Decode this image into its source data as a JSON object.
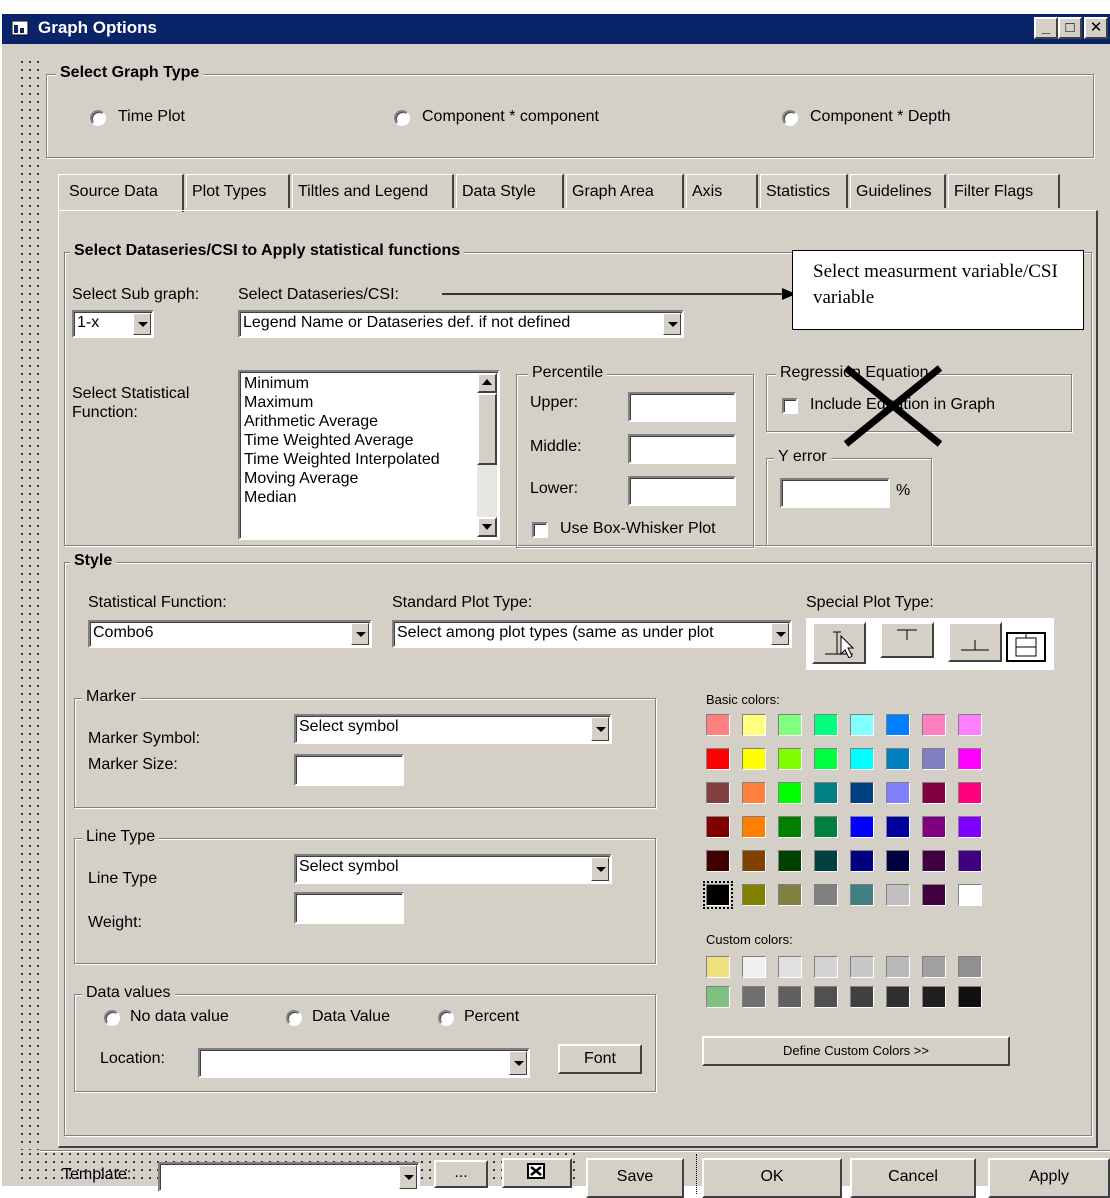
{
  "window": {
    "title": "Graph Options"
  },
  "graph_type": {
    "legend": "Select Graph Type",
    "options": [
      "Time Plot",
      "Component * component",
      "Component * Depth"
    ]
  },
  "tabs": [
    "Source Data",
    "Plot Types",
    "Tiltles and Legend",
    "Data Style",
    "Graph Area",
    "Axis",
    "Statistics",
    "Guidelines",
    "Filter Flags"
  ],
  "dataseries": {
    "legend": "Select Dataseries/CSI  to Apply statistical functions",
    "sub_graph_label": "Select Sub graph:",
    "sub_graph_value": "1-x",
    "dataseries_label": "Select Dataseries/CSI:",
    "dataseries_value": "Legend Name or Dataseries def. if not defined",
    "stat_function_label": "Select Statistical Function:",
    "functions": [
      "Minimum",
      "Maximum",
      "Arithmetic Average",
      "Time Weighted Average",
      "Time Weighted Interpolated",
      "Moving Average",
      "Median"
    ]
  },
  "percentile": {
    "legend": "Percentile",
    "upper": "Upper:",
    "middle": "Middle:",
    "lower": "Lower:",
    "boxwhisker": "Use Box-Whisker Plot"
  },
  "regression": {
    "legend": "Regression Equation",
    "include": "Include Equation in Graph"
  },
  "yerror": {
    "legend": "Y error",
    "unit": "%"
  },
  "annotation": {
    "text": "Select measurment variable/CSI variable"
  },
  "style": {
    "legend": "Style",
    "stat_func_label": "Statistical Function:",
    "stat_func_value": "Combo6",
    "std_plot_label": "Standard Plot Type:",
    "std_plot_value": "Select among  plot types (same as under plot",
    "special_plot_label": "Special Plot Type:"
  },
  "marker": {
    "legend": "Marker",
    "symbol_label": "Marker Symbol:",
    "symbol_value": "Select symbol",
    "size_label": "Marker Size:"
  },
  "linetype": {
    "legend": "Line Type",
    "type_label": "Line Type",
    "type_value": "Select symbol",
    "weight_label": "Weight:"
  },
  "datavalues": {
    "legend": "Data values",
    "options": [
      "No data value",
      "Data Value",
      "Percent"
    ],
    "location_label": "Location:",
    "font_button": "Font"
  },
  "colors": {
    "basic_label": "Basic colors:",
    "custom_label": "Custom colors:",
    "define_button": "Define Custom Colors >>",
    "basic": [
      "#ff8080",
      "#ffff80",
      "#80ff80",
      "#00ff80",
      "#80ffff",
      "#0080ff",
      "#ff80c0",
      "#ff80ff",
      "#ff0000",
      "#ffff00",
      "#80ff00",
      "#00ff40",
      "#00ffff",
      "#0080c0",
      "#8080c0",
      "#ff00ff",
      "#804040",
      "#ff8040",
      "#00ff00",
      "#008080",
      "#004080",
      "#8080ff",
      "#800040",
      "#ff0080",
      "#800000",
      "#ff8000",
      "#008000",
      "#008040",
      "#0000ff",
      "#0000a0",
      "#800080",
      "#8000ff",
      "#400000",
      "#804000",
      "#004000",
      "#004040",
      "#000080",
      "#000040",
      "#400040",
      "#400080",
      "#000000",
      "#808000",
      "#808040",
      "#808080",
      "#408080",
      "#c0c0c0",
      "#400040",
      "#ffffff"
    ],
    "custom": [
      "#f0e080",
      "#f0f0f0",
      "#e0e0e0",
      "#d4d4d4",
      "#c8c8c8",
      "#b8b8b8",
      "#a0a0a0",
      "#909090",
      "#80c080",
      "#707070",
      "#606060",
      "#505050",
      "#404040",
      "#303030",
      "#202020",
      "#101010"
    ]
  },
  "bottom": {
    "template_label": "Template:",
    "browse_button": "...",
    "save_button": "Save",
    "ok_button": "OK",
    "cancel_button": "Cancel",
    "apply_button": "Apply"
  }
}
